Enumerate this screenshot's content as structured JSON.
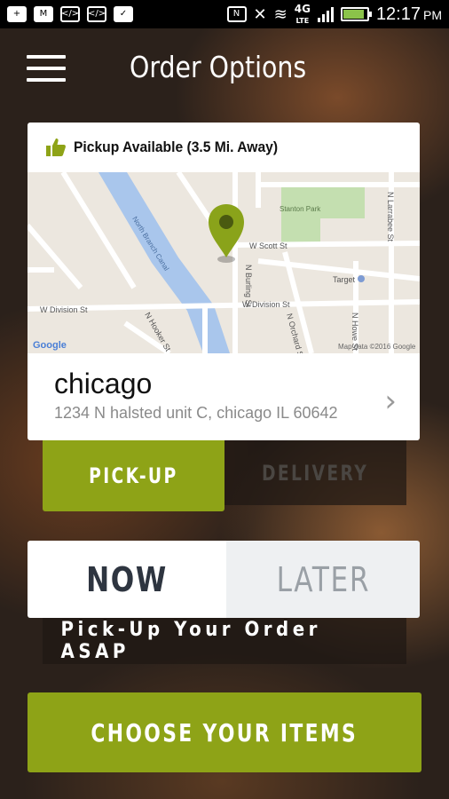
{
  "status_bar": {
    "time": "12:17",
    "ampm": "PM",
    "network": "4G",
    "network_sub": "LTE",
    "nfc_glyph": "N"
  },
  "header": {
    "title": "Order Options",
    "menu_icon": "hamburger-menu-icon"
  },
  "location_card": {
    "availability": "Pickup Available (3.5 Mi. Away)",
    "availability_icon": "thumbs-up-icon",
    "map": {
      "streets": [
        "W Scott St",
        "W Division St",
        "W Division St",
        "N Burling St",
        "N Orchard St",
        "N Howe St",
        "N Larrabee St",
        "N Hooker St"
      ],
      "park": "Stanton Park",
      "canal": "North Branch Canal",
      "poi": "Target",
      "logo": "Google",
      "attribution": "Map data ©2016 Google"
    },
    "name": "chicago",
    "address": "1234 N halsted unit C, chicago IL 60642"
  },
  "mode_toggle": {
    "pickup_label": "PICK-UP",
    "delivery_label": "DELIVERY",
    "selected": "pickup"
  },
  "time_toggle": {
    "now_label": "NOW",
    "later_label": "LATER",
    "selected": "now",
    "hint": "Pick-Up Your Order ASAP"
  },
  "cta": {
    "label": "CHOOSE YOUR ITEMS"
  },
  "colors": {
    "accent": "#8ea317",
    "pin": "#8aa31a",
    "card_bg": "#ffffff"
  }
}
